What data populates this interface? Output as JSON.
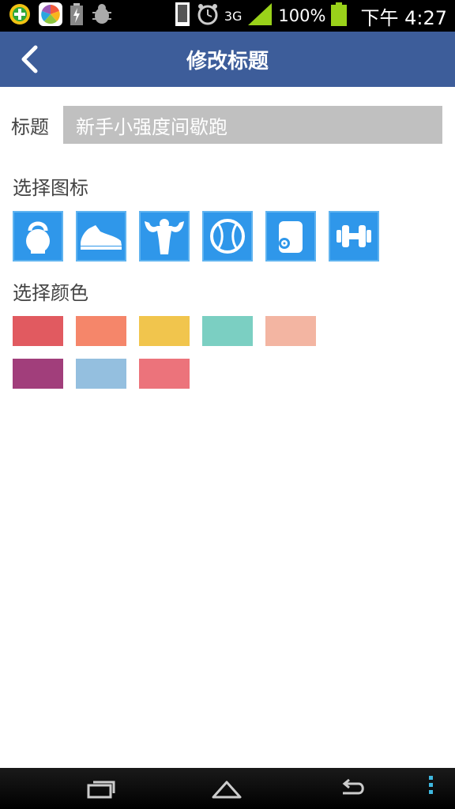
{
  "status_bar": {
    "network": "3G",
    "battery": "100%",
    "time": "下午 4:27"
  },
  "header": {
    "title": "修改标题"
  },
  "form": {
    "title_label": "标题",
    "title_value": "新手小强度间歇跑"
  },
  "icon_section": {
    "label": "选择图标",
    "icons": [
      "kettlebell-icon",
      "sneaker-icon",
      "bodybuilder-icon",
      "ball-icon",
      "yoga-mat-icon",
      "dumbbell-icon"
    ],
    "tile_color": "#2f97ea"
  },
  "color_section": {
    "label": "选择颜色",
    "colors": [
      "#e15a60",
      "#f5866a",
      "#f1c54d",
      "#7bcfc2",
      "#f3b5a2",
      "#a13e7b",
      "#94bfdf",
      "#ec737b"
    ]
  },
  "theme": {
    "header_color": "#3d5d9a",
    "input_bg": "#c0c0c0"
  }
}
